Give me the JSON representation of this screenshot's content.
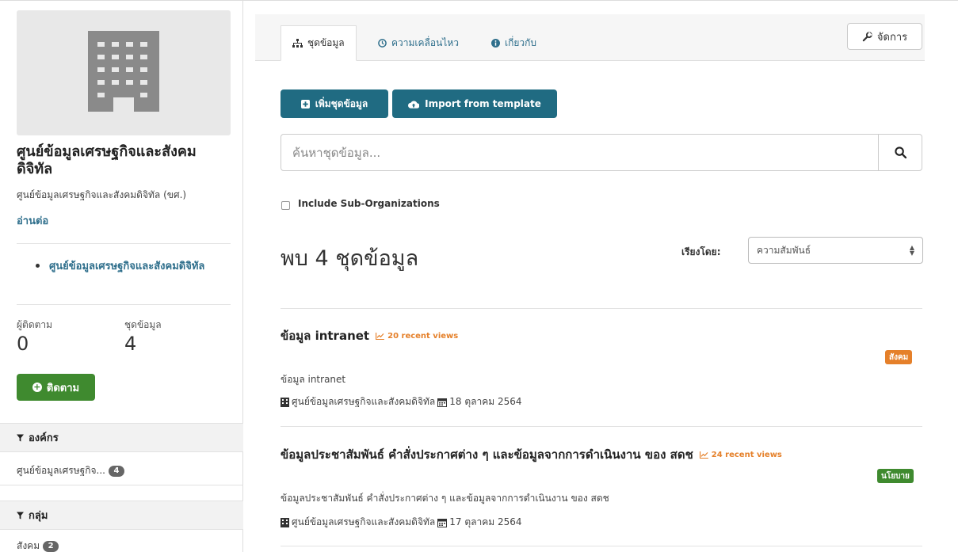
{
  "organization": {
    "title": "ศูนย์ข้อมูลเศรษฐกิจและสังคมดิจิทัล",
    "description": "ศูนย์ข้อมูลเศรษฐกิจและสังคมดิจิทัล (ขศ.)",
    "read_more": "อ่านต่อ",
    "tree_item": "ศูนย์ข้อมูลเศรษฐกิจและสังคมดิจิทัล",
    "image_icon": "building-icon"
  },
  "stats": {
    "followers_label": "ผู้ติดตาม",
    "followers_value": "0",
    "datasets_label": "ชุดข้อมูล",
    "datasets_value": "4"
  },
  "follow_button": "ติดตาม",
  "facets": [
    {
      "title": "องค์กร",
      "items": [
        {
          "label": "ศูนย์ข้อมูลเศรษฐกิจ...",
          "count": "4"
        }
      ]
    },
    {
      "title": "กลุ่ม",
      "items": [
        {
          "label": "สังคม",
          "count": "2"
        }
      ]
    }
  ],
  "tabs": [
    {
      "label": "ชุดข้อมูล",
      "icon": "sitemap-icon",
      "active": true
    },
    {
      "label": "ความเคลื่อนไหว",
      "icon": "clock-icon",
      "active": false
    },
    {
      "label": "เกี่ยวกับ",
      "icon": "info-icon",
      "active": false
    }
  ],
  "manage_button": "จัดการ",
  "actions": {
    "add_dataset": "เพิ่มชุดข้อมูล",
    "import_template": "Import from template"
  },
  "search": {
    "placeholder": "ค้นหาชุดข้อมูล..."
  },
  "include_sub_orgs": "Include Sub-Organizations",
  "results_title": "พบ 4 ชุดข้อมูล",
  "sort": {
    "label": "เรียงโดย:",
    "selected": "ความสัมพันธ์"
  },
  "datasets": [
    {
      "title": "ข้อมูล intranet",
      "recent_views": "20 recent views",
      "tag": "สังคม",
      "notes": "ข้อมูล intranet",
      "org": "ศูนย์ข้อมูลเศรษฐกิจและสังคมดิจิทัล",
      "date": "18 ตุลาคม 2564"
    },
    {
      "title": "ข้อมูลประชาสัมพันธ์ คำสั่งประกาศต่าง ๆ และข้อมูลจากการดำเนินงาน ของ สดช",
      "recent_views": "24 recent views",
      "tag": "นโยบาย",
      "notes": "ข้อมูลประชาสัมพันธ์ คำสั่งประกาศต่าง ๆ และข้อมูลจากการดำเนินงาน ของ สดช",
      "org": "ศูนย์ข้อมูลเศรษฐกิจและสังคมดิจิทัล",
      "date": "17 ตุลาคม 2564"
    }
  ],
  "colors": {
    "primary": "#206b82",
    "follow": "#3f8a2f",
    "link": "#2f6f8c",
    "tag_social": "#e5802a",
    "tag_policy": "#3f8a2f",
    "recent_views": "#e5802a"
  }
}
